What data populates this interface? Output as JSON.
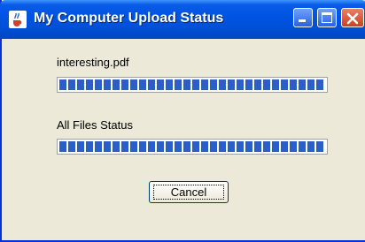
{
  "window": {
    "title": "My Computer Upload Status",
    "icon": "java-cup-icon",
    "controls": [
      "minimize",
      "maximize",
      "close"
    ]
  },
  "file": {
    "name": "interesting.pdf",
    "progress": 1.0
  },
  "all_files": {
    "label": "All Files Status",
    "progress": 1.0
  },
  "buttons": {
    "cancel_label": "Cancel"
  },
  "colors": {
    "progress_fill": "#2c5ec8",
    "titlebar": "#0054e3",
    "window_bg": "#ece9d8"
  }
}
